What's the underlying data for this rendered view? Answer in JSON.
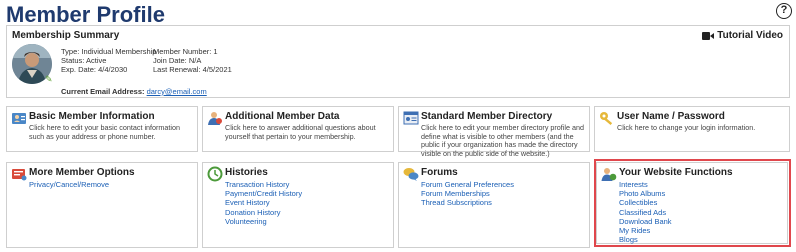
{
  "page": {
    "title": "Member Profile",
    "help_label": "?"
  },
  "summary": {
    "title": "Membership Summary",
    "tutorial_label": "Tutorial Video",
    "type": "Type: Individual Membership",
    "status": "Status: Active",
    "exp_date": "Exp. Date: 4/4/2030",
    "member_number": "Member Number: 1",
    "join_date": "Join Date: N/A",
    "last_renewal": "Last Renewal: 4/5/2021",
    "email_label": "Current Email Address:",
    "email": "darcy@email.com"
  },
  "cards": {
    "basic": {
      "title": "Basic Member Information",
      "desc": "Click here to edit your basic contact information such as your address or phone number."
    },
    "additional": {
      "title": "Additional Member Data",
      "desc": "Click here to answer additional questions about yourself that pertain to your membership."
    },
    "directory": {
      "title": "Standard Member Directory",
      "desc": "Click here to edit your member directory profile and define what is visible to other members (and the public if your organization has made the directory visible on the public side of the website.)"
    },
    "username": {
      "title": "User Name / Password",
      "desc": "Click here to change your login information."
    },
    "options": {
      "title": "More Member Options",
      "links": [
        "Privacy/Cancel/Remove"
      ]
    },
    "histories": {
      "title": "Histories",
      "links": [
        "Transaction History",
        "Payment/Credit History",
        "Event History",
        "Donation History",
        "Volunteering"
      ]
    },
    "forums": {
      "title": "Forums",
      "links": [
        "Forum General Preferences",
        "Forum Memberships",
        "Thread Subscriptions"
      ]
    },
    "website": {
      "title": "Your Website Functions",
      "links": [
        "Interests",
        "Photo Albums",
        "Collectibles",
        "Classified Ads",
        "Download Bank",
        "My Rides",
        "Blogs"
      ]
    }
  },
  "colors": {
    "title": "#1f3a6e",
    "link": "#1b5fb5",
    "highlight": "#e0474c"
  }
}
